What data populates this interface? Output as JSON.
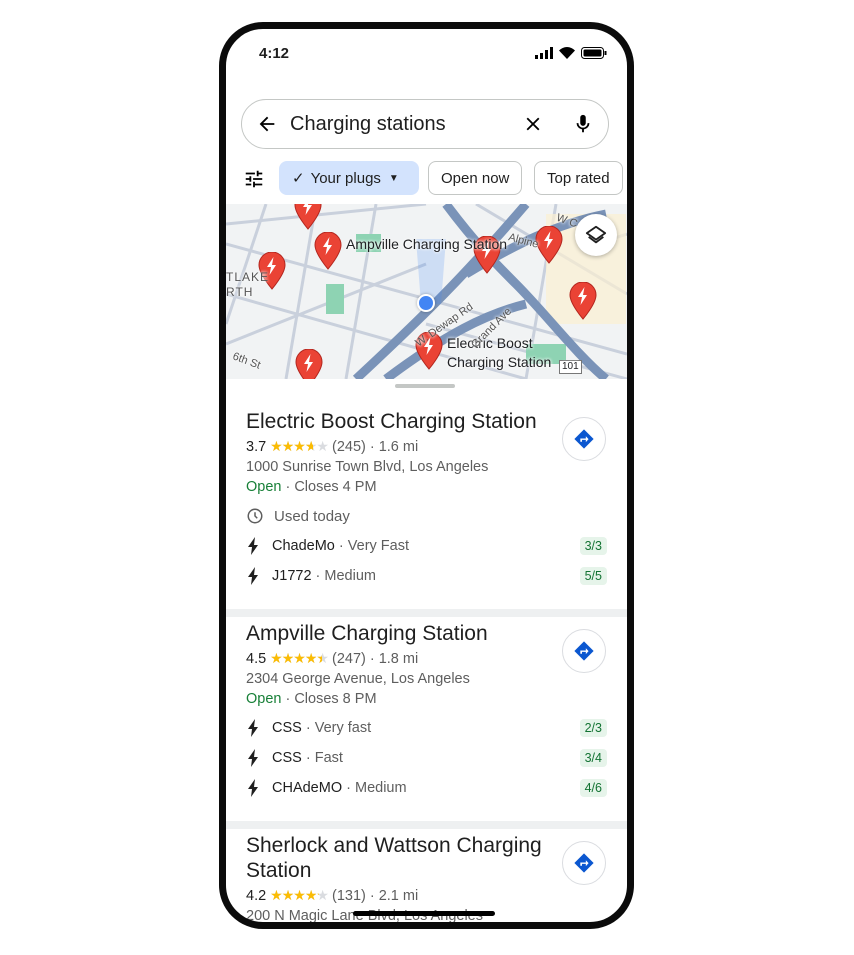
{
  "status_bar": {
    "time": "4:12"
  },
  "search": {
    "query": "Charging stations"
  },
  "filters": [
    {
      "label": "Your plugs",
      "selected": true
    },
    {
      "label": "Open now"
    },
    {
      "label": "Top rated"
    }
  ],
  "map": {
    "labels": {
      "ampville": "Ampville Charging Station",
      "electric": "Electric Boost Charging Station",
      "district1": "TLAKE",
      "district2": "RTH",
      "street1": "W. Dewap Rd",
      "street2": "Grand Ave",
      "street3": "6th St",
      "street4": "Alpine",
      "street5": "W C",
      "highway": "101"
    },
    "pin_color": "#ea4335",
    "location_color": "#4285f4"
  },
  "results": [
    {
      "name": "Electric Boost Charging Station",
      "rating": "3.7",
      "stars": 3.7,
      "reviews": "(245)",
      "distance": "1.6 mi",
      "address": "1000 Sunrise Town Blvd, Los Angeles",
      "open": "Open",
      "closes": "Closes 4 PM",
      "used": "Used today",
      "plugs": [
        {
          "name": "ChadeMo",
          "speed": "Very Fast",
          "avail": "3/3"
        },
        {
          "name": "J1772",
          "speed": "Medium",
          "avail": "5/5"
        }
      ]
    },
    {
      "name": "Ampville Charging Station",
      "rating": "4.5",
      "stars": 4.5,
      "reviews": "(247)",
      "distance": "1.8 mi",
      "address": "2304 George Avenue, Los Angeles",
      "open": "Open",
      "closes": "Closes 8 PM",
      "plugs": [
        {
          "name": "CSS",
          "speed": "Very fast",
          "avail": "2/3"
        },
        {
          "name": "CSS",
          "speed": "Fast",
          "avail": "3/4"
        },
        {
          "name": "CHAdeMO",
          "speed": "Medium",
          "avail": "4/6"
        }
      ]
    },
    {
      "name": "Sherlock and Wattson Charging Station",
      "rating": "4.2",
      "stars": 4.2,
      "reviews": "(131)",
      "distance": "2.1 mi",
      "address": "200 N Magic Lane Blvd, Los Angeles"
    }
  ]
}
